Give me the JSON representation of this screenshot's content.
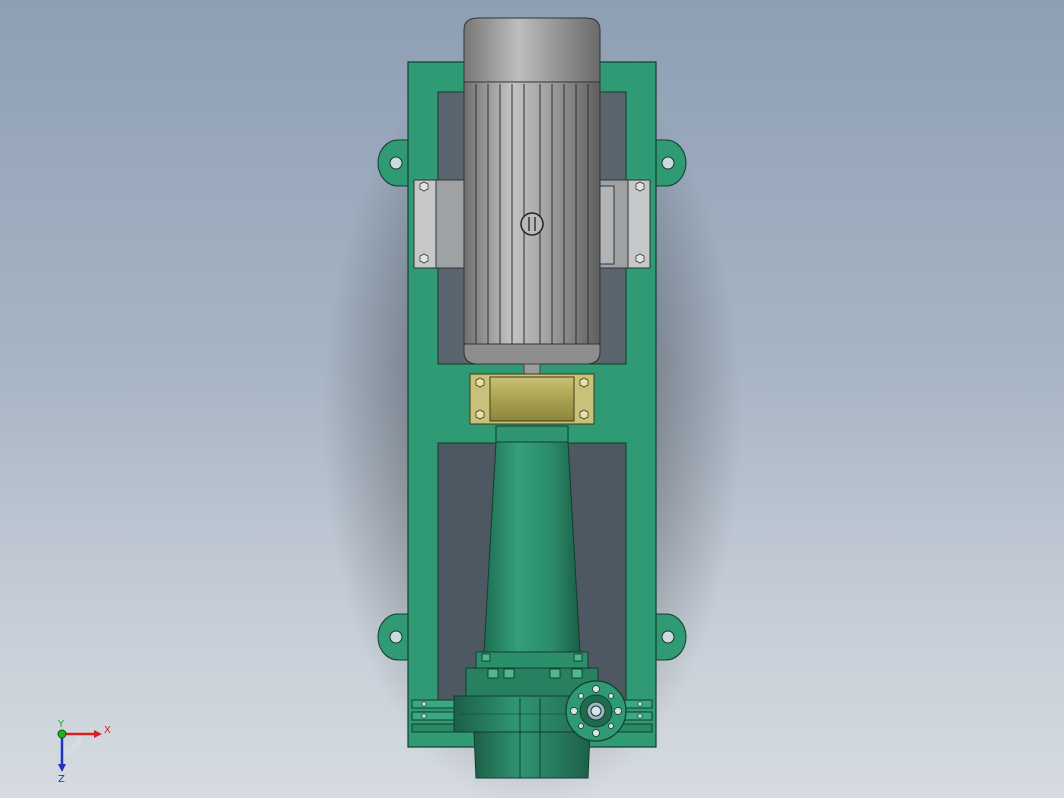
{
  "view": {
    "colors": {
      "background_top": "#8e9fb4",
      "background_bottom": "#d6dbe1",
      "frame_green": "#2f9a73",
      "frame_dark": "#1f6b50",
      "motor_gray": "#9a9a9a",
      "coupling_olive": "#b3ad5c",
      "pump_green": "#2e8e6c"
    }
  },
  "triad": {
    "x_label": "X",
    "y_label": "Y",
    "z_label": "Z",
    "x_color": "#d42020",
    "y_color": "#20b020",
    "z_color": "#2030c0"
  }
}
